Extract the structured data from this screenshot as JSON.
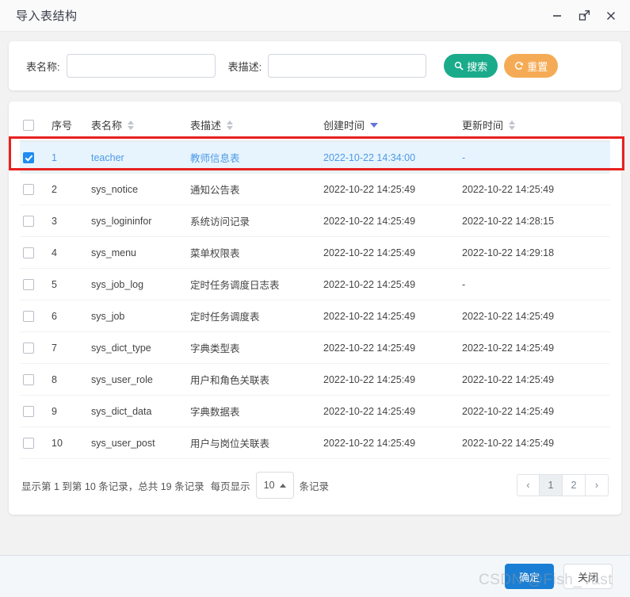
{
  "window": {
    "title": "导入表结构",
    "minimize_icon": "minimize-icon",
    "maximize_icon": "maximize-icon",
    "close_icon": "close-icon"
  },
  "search": {
    "table_name_label": "表名称:",
    "table_name_value": "",
    "table_name_placeholder": "",
    "table_desc_label": "表描述:",
    "table_desc_value": "",
    "table_desc_placeholder": "",
    "search_button": "搜索",
    "reset_button": "重置",
    "search_icon": "search-icon",
    "reset_icon": "refresh-icon",
    "search_color": "#1aab8b",
    "reset_color": "#f5ab55"
  },
  "table": {
    "columns": [
      {
        "label": "",
        "sortable": false,
        "sort": "none"
      },
      {
        "label": "序号",
        "sortable": false,
        "sort": "none"
      },
      {
        "label": "表名称",
        "sortable": true,
        "sort": "none"
      },
      {
        "label": "表描述",
        "sortable": true,
        "sort": "none"
      },
      {
        "label": "创建时间",
        "sortable": true,
        "sort": "desc"
      },
      {
        "label": "更新时间",
        "sortable": true,
        "sort": "none"
      }
    ],
    "rows": [
      {
        "checked": true,
        "index": "1",
        "name": "teacher",
        "desc": "教师信息表",
        "created": "2022-10-22 14:34:00",
        "updated": "-"
      },
      {
        "checked": false,
        "index": "2",
        "name": "sys_notice",
        "desc": "通知公告表",
        "created": "2022-10-22 14:25:49",
        "updated": "2022-10-22 14:25:49"
      },
      {
        "checked": false,
        "index": "3",
        "name": "sys_logininfor",
        "desc": "系统访问记录",
        "created": "2022-10-22 14:25:49",
        "updated": "2022-10-22 14:28:15"
      },
      {
        "checked": false,
        "index": "4",
        "name": "sys_menu",
        "desc": "菜单权限表",
        "created": "2022-10-22 14:25:49",
        "updated": "2022-10-22 14:29:18"
      },
      {
        "checked": false,
        "index": "5",
        "name": "sys_job_log",
        "desc": "定时任务调度日志表",
        "created": "2022-10-22 14:25:49",
        "updated": "-"
      },
      {
        "checked": false,
        "index": "6",
        "name": "sys_job",
        "desc": "定时任务调度表",
        "created": "2022-10-22 14:25:49",
        "updated": "2022-10-22 14:25:49"
      },
      {
        "checked": false,
        "index": "7",
        "name": "sys_dict_type",
        "desc": "字典类型表",
        "created": "2022-10-22 14:25:49",
        "updated": "2022-10-22 14:25:49"
      },
      {
        "checked": false,
        "index": "8",
        "name": "sys_user_role",
        "desc": "用户和角色关联表",
        "created": "2022-10-22 14:25:49",
        "updated": "2022-10-22 14:25:49"
      },
      {
        "checked": false,
        "index": "9",
        "name": "sys_dict_data",
        "desc": "字典数据表",
        "created": "2022-10-22 14:25:49",
        "updated": "2022-10-22 14:25:49"
      },
      {
        "checked": false,
        "index": "10",
        "name": "sys_user_post",
        "desc": "用户与岗位关联表",
        "created": "2022-10-22 14:25:49",
        "updated": "2022-10-22 14:25:49"
      }
    ],
    "header_checkbox_checked": false
  },
  "pagination": {
    "info_prefix": "显示第 1 到第 10 条记录，总共 19 条记录",
    "per_page_label": "每页显示",
    "per_page_value": "10",
    "records_suffix": "条记录",
    "prev_label": "‹",
    "next_label": "›",
    "pages": [
      "1",
      "2"
    ],
    "active_page": "1"
  },
  "footer": {
    "confirm_button": "确定",
    "close_button": "关闭",
    "confirm_color": "#1a7fd4"
  },
  "watermark": {
    "text": "CSDN @Fish_Vast"
  }
}
